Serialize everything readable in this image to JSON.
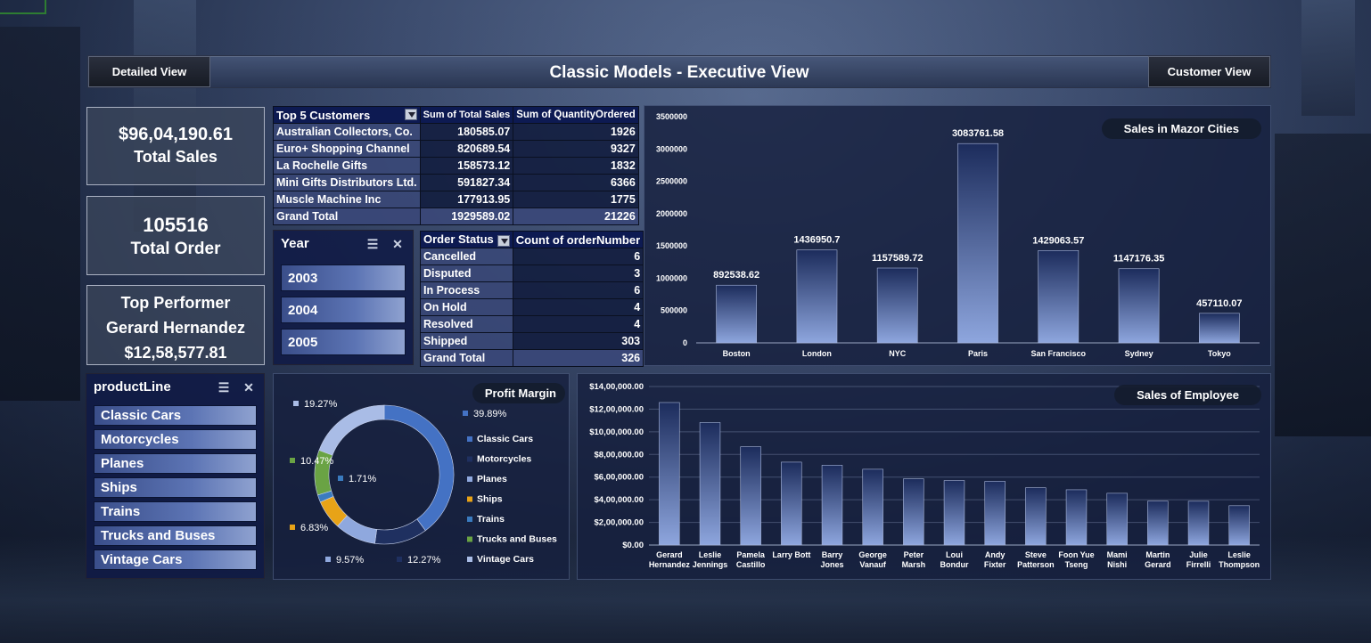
{
  "header": {
    "title": "Classic Models - Executive View",
    "left_button": "Detailed View",
    "right_button": "Customer View"
  },
  "kpis": {
    "total_sales_value": "$96,04,190.61",
    "total_sales_label": "Total Sales",
    "total_order_value": "105516",
    "total_order_label": "Total Order",
    "top_performer_label": "Top Performer",
    "top_performer_name": "Gerard Hernandez",
    "top_performer_value": "$12,58,577.81"
  },
  "top_customers": {
    "headers": [
      "Top 5 Customers",
      "Sum of Total Sales",
      "Sum of QuantityOrdered"
    ],
    "rows": [
      [
        "Australian Collectors, Co.",
        "180585.07",
        "1926"
      ],
      [
        "Euro+ Shopping Channel",
        "820689.54",
        "9327"
      ],
      [
        "La Rochelle Gifts",
        "158573.12",
        "1832"
      ],
      [
        "Mini Gifts Distributors Ltd.",
        "591827.34",
        "6366"
      ],
      [
        "Muscle Machine Inc",
        "177913.95",
        "1775"
      ]
    ],
    "total": [
      "Grand Total",
      "1929589.02",
      "21226"
    ]
  },
  "year_slicer": {
    "title": "Year",
    "items": [
      "2003",
      "2004",
      "2005"
    ]
  },
  "order_status": {
    "headers": [
      "Order Status",
      "Count of orderNumber"
    ],
    "rows": [
      [
        "Cancelled",
        "6"
      ],
      [
        "Disputed",
        "3"
      ],
      [
        "In Process",
        "6"
      ],
      [
        "On Hold",
        "4"
      ],
      [
        "Resolved",
        "4"
      ],
      [
        "Shipped",
        "303"
      ]
    ],
    "total": [
      "Grand Total",
      "326"
    ]
  },
  "productline_slicer": {
    "title": "productLine",
    "items": [
      "Classic Cars",
      "Motorcycles",
      "Planes",
      "Ships",
      "Trains",
      "Trucks and Buses",
      "Vintage Cars"
    ]
  },
  "chart_data": [
    {
      "type": "bar",
      "title": "Sales in Mazor Cities",
      "categories": [
        "Boston",
        "London",
        "NYC",
        "Paris",
        "San Francisco",
        "Sydney",
        "Tokyo"
      ],
      "values": [
        892538.62,
        1436950.7,
        1157589.72,
        3083761.58,
        1429063.57,
        1147176.35,
        457110.07
      ],
      "data_labels": [
        "892538.62",
        "1436950.7",
        "1157589.72",
        "3083761.58",
        "1429063.57",
        "1147176.35",
        "457110.07"
      ],
      "ylim": [
        0,
        3500000
      ],
      "yticks": [
        "0",
        "500000",
        "1000000",
        "1500000",
        "2000000",
        "2500000",
        "3000000",
        "3500000"
      ],
      "grid": false
    },
    {
      "type": "pie",
      "title": "Profit Margin",
      "categories": [
        "Classic Cars",
        "Motorcycles",
        "Planes",
        "Ships",
        "Trains",
        "Trucks and Buses",
        "Vintage Cars"
      ],
      "values": [
        39.89,
        12.27,
        9.57,
        6.83,
        1.71,
        10.47,
        19.27
      ],
      "data_labels": [
        "39.89%",
        "12.27%",
        "9.57%",
        "6.83%",
        "1.71%",
        "10.47%",
        "19.27%"
      ],
      "colors": [
        "#4472c4",
        "#1f3060",
        "#8fa8de",
        "#e8a317",
        "#3a7bbf",
        "#6aa344",
        "#a9bce6"
      ],
      "legend": "right"
    },
    {
      "type": "bar",
      "title": "Sales of Employee",
      "categories": [
        "Gerard Hernandez",
        "Leslie Jennings",
        "Pamela Castillo",
        "Larry Bott",
        "Barry Jones",
        "George Vanauf",
        "Peter Marsh",
        "Loui Bondur",
        "Andy Fixter",
        "Steve Patterson",
        "Foon Yue Tseng",
        "Mami Nishi",
        "Martin Gerard",
        "Julie Firrelli",
        "Leslie Thompson"
      ],
      "category_lines": [
        [
          "Gerard",
          "Hernandez"
        ],
        [
          "Leslie",
          "Jennings"
        ],
        [
          "Pamela",
          "Castillo"
        ],
        [
          "Larry Bott"
        ],
        [
          "Barry",
          "Jones"
        ],
        [
          "George",
          "Vanauf"
        ],
        [
          "Peter",
          "Marsh"
        ],
        [
          "Loui",
          "Bondur"
        ],
        [
          "Andy",
          "Fixter"
        ],
        [
          "Steve",
          "Patterson"
        ],
        [
          "Foon Yue",
          "Tseng"
        ],
        [
          "Mami",
          "Nishi"
        ],
        [
          "Martin",
          "Gerard"
        ],
        [
          "Julie",
          "Firrelli"
        ],
        [
          "Leslie",
          "Thompson"
        ]
      ],
      "values": [
        1258577.81,
        1081530.54,
        868220.55,
        732096.79,
        704853.91,
        669377.05,
        584593.76,
        569485.75,
        562582.59,
        505875.42,
        488212.67,
        457110.07,
        387477.47,
        386663.2,
        347533.03
      ],
      "ylim": [
        0,
        1400000
      ],
      "yticks": [
        "$0.00",
        "$2,00,000.00",
        "$4,00,000.00",
        "$6,00,000.00",
        "$8,00,000.00",
        "$10,00,000.00",
        "$12,00,000.00",
        "$14,00,000.00"
      ],
      "grid": true
    }
  ]
}
